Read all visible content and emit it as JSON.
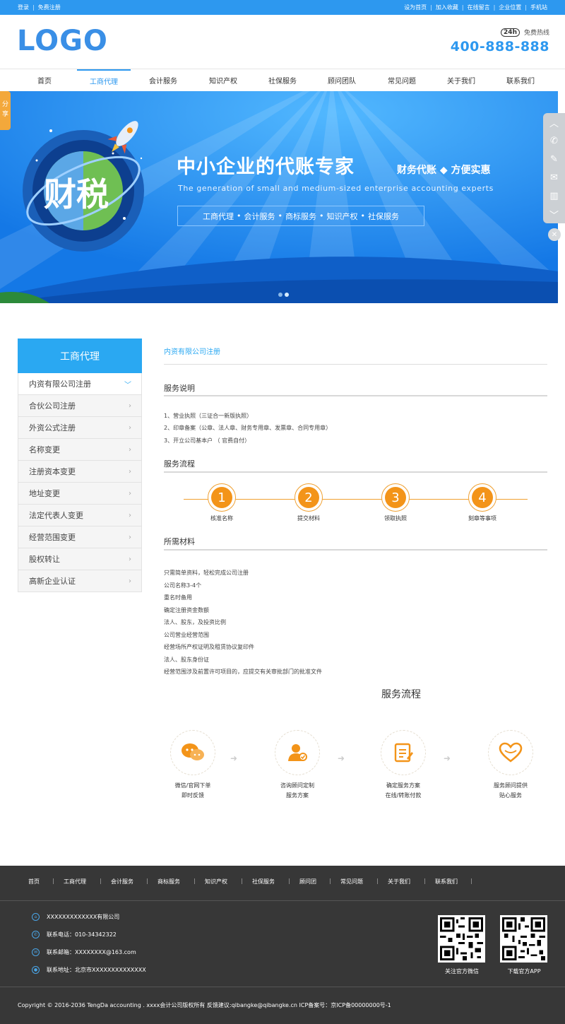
{
  "topbar": {
    "left": [
      "登录",
      "免费注册"
    ],
    "right": [
      "设为首页",
      "加入收藏",
      "在线留言",
      "企业位置",
      "手机站"
    ],
    "color": "#2d98ef"
  },
  "header": {
    "logo": "LOGO",
    "hotline_badge": "24h",
    "hotline_label": "免费热线",
    "hotline_number": "400-888-888"
  },
  "nav": {
    "items": [
      "首页",
      "工商代理",
      "会计服务",
      "知识产权",
      "社保服务",
      "顾问团队",
      "常见问题",
      "关于我们",
      "联系我们"
    ],
    "active_index": 1
  },
  "banner": {
    "badge": "财税",
    "title": "中小企业的代账专家",
    "subtitle": "财务代账 ◆ 方便实惠",
    "english": "The generation of small and medium-sized enterprise accounting experts",
    "tags": [
      "工商代理",
      "会计服务",
      "商标服务",
      "知识产权",
      "社保服务"
    ],
    "tag_separator": "•"
  },
  "share_tab": "分享",
  "side_tools": [
    "chevron-up",
    "phone",
    "edit",
    "mail",
    "map",
    "chevron-down"
  ],
  "left_menu": {
    "title": "工商代理",
    "items": [
      "内资有限公司注册",
      "合伙公司注册",
      "外资公式注册",
      "名称变更",
      "注册资本变更",
      "地址变更",
      "法定代表人变更",
      "经营范围变更",
      "股权转让",
      "高新企业认证"
    ]
  },
  "content": {
    "breadcrumb": "内资有限公司注册",
    "service_desc_title": "服务说明",
    "service_desc": [
      "1、营业执照（三证合一新版执照）",
      "2、印章备案（公章、法人章、财务专用章、发票章、合同专用章）",
      "3、开立公司基本户 （ 官费自付）"
    ],
    "process_title": "服务流程",
    "steps": [
      {
        "num": "1",
        "label": "核准名称"
      },
      {
        "num": "2",
        "label": "提交材料"
      },
      {
        "num": "3",
        "label": "领取执照"
      },
      {
        "num": "4",
        "label": "刻章等事项"
      }
    ],
    "materials_title": "所需材料",
    "materials": [
      "只需简单资料，轻松完成公司注册",
      "公司名称3-4个",
      "重名时备用",
      "确定注册资金数额",
      "法人、股东，及投资比例",
      "公司营业经营范围",
      "经营场所产权证明及租赁协议复印件",
      "法人、股东身份证",
      "经营范围涉及前置许可项目的，应提交有关审批部门的批准文件"
    ]
  },
  "flow": {
    "title": "服务流程",
    "items": [
      {
        "icon": "wechat-icon",
        "l1": "微信/官网下单",
        "l2": "即时反馈"
      },
      {
        "icon": "consultant-icon",
        "l1": "咨询顾问定制",
        "l2": "服务方案"
      },
      {
        "icon": "document-icon",
        "l1": "确定服务方案",
        "l2": "在线/转账付款"
      },
      {
        "icon": "heart-icon",
        "l1": "服务顾问提供",
        "l2": "贴心服务"
      }
    ],
    "accent": "#f39419"
  },
  "footer": {
    "nav": [
      "首页",
      "工商代理",
      "会计服务",
      "商标服务",
      "知识产权",
      "社保服务",
      "顾问团",
      "常见问题",
      "关于我们",
      "联系我们"
    ],
    "company": "XXXXXXXXXXXXX有限公司",
    "phone": "联系电话：010-34342322",
    "email": "联系邮箱：XXXXXXXX@163.com",
    "address": "联系地址：北京市XXXXXXXXXXXXXX",
    "qr1_label": "关注官方微信",
    "qr2_label": "下载官方APP",
    "copyright": "Copyright © 2016-2036 TengDa accounting . xxxx会计公司版权所有   反馈建议:qibangke@qibangke.cn   ICP备案号：京ICP备00000000号-1",
    "bg": "#373737"
  }
}
